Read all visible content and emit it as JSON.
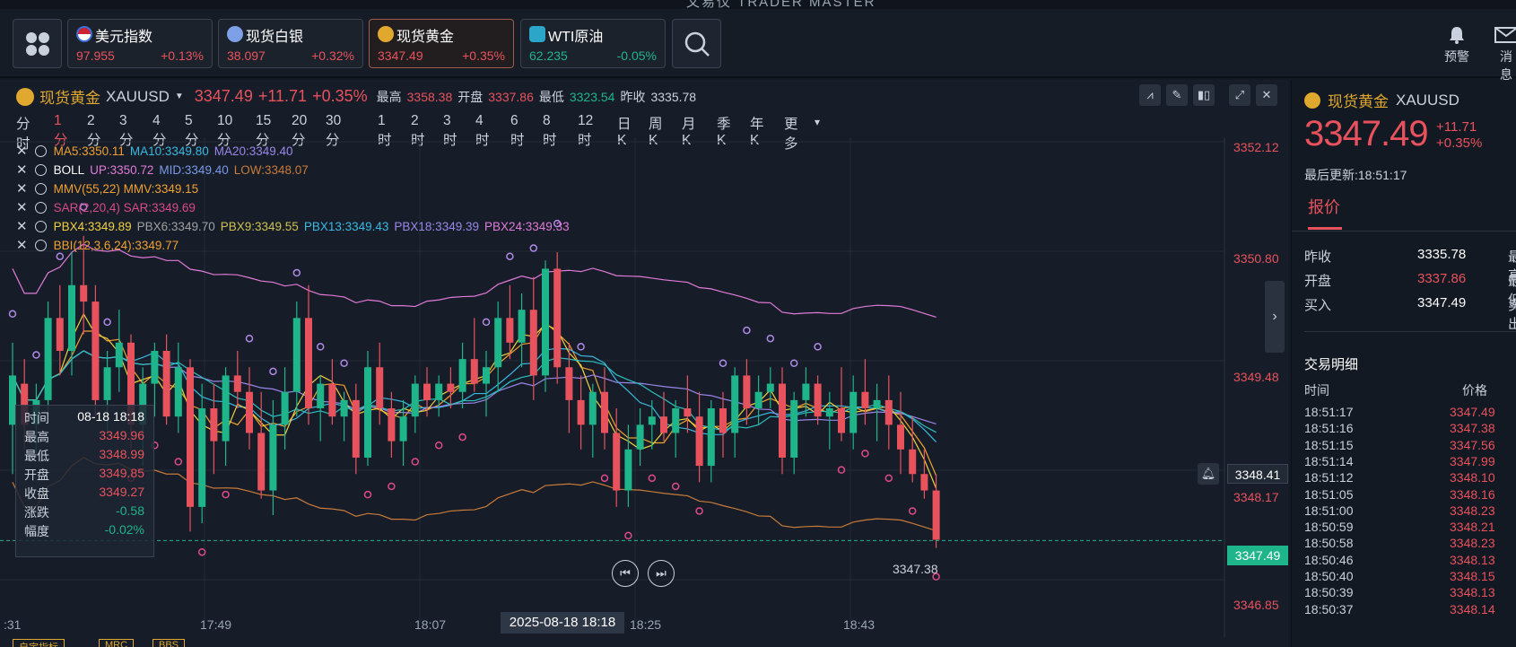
{
  "window": {
    "title": "文易仪 TRADER MASTER"
  },
  "header": {
    "tickers": [
      {
        "name": "美元指数",
        "price": "97.955",
        "change": "+0.13%",
        "icon": "us-flag-icon",
        "color": "#3a6fd8"
      },
      {
        "name": "现货白银",
        "price": "38.097",
        "change": "+0.32%",
        "icon": "silver-icon",
        "color": "#7da0e8"
      },
      {
        "name": "现货黄金",
        "price": "3347.49",
        "change": "+0.35%",
        "icon": "gold-icon",
        "color": "#e0a82e"
      },
      {
        "name": "WTI原油",
        "price": "62.235",
        "change": "-0.05%",
        "icon": "oil-icon",
        "color": "#2ba6c8"
      }
    ],
    "alerts_label": "预警",
    "messages_label": "消息"
  },
  "chart_header": {
    "symbol_name": "现货黄金",
    "symbol_code": "XAUUSD",
    "price": "3347.49",
    "change": "+11.71",
    "change_pct": "+0.35%",
    "high_label": "最高",
    "high": "3358.38",
    "open_label": "开盘",
    "open": "3337.86",
    "low_label": "最低",
    "low": "3323.54",
    "prev_label": "昨收",
    "prev": "3335.78"
  },
  "intervals": [
    "分时",
    "1分",
    "2分",
    "3分",
    "4分",
    "5分",
    "10分",
    "15分",
    "20分",
    "30分",
    "1时",
    "2时",
    "3时",
    "4时",
    "6时",
    "8时",
    "12时",
    "日K",
    "周K",
    "月K",
    "季K",
    "年K",
    "更多"
  ],
  "indicators": [
    {
      "parts": [
        {
          "t": "MA5:3350.11",
          "c": "#f0a030"
        },
        {
          "t": "MA10:3349.80",
          "c": "#3ab8e0"
        },
        {
          "t": "MA20:3349.40",
          "c": "#9a86e8"
        }
      ]
    },
    {
      "parts": [
        {
          "t": "BOLL",
          "c": "#ffffff"
        },
        {
          "t": "UP:3350.72",
          "c": "#e07ad8"
        },
        {
          "t": "MID:3349.40",
          "c": "#7a9ae8"
        },
        {
          "t": "LOW:3348.07",
          "c": "#c87a3a"
        }
      ]
    },
    {
      "parts": [
        {
          "t": "MMV(55,22) MMV:3349.15",
          "c": "#f0a030"
        }
      ]
    },
    {
      "parts": [
        {
          "t": "SAR(2,20,4) SAR:3349.69",
          "c": "#d84a8a"
        }
      ]
    },
    {
      "parts": [
        {
          "t": "PBX4:3349.89",
          "c": "#f0d040"
        },
        {
          "t": "PBX6:3349.70",
          "c": "#a0a0a0"
        },
        {
          "t": "PBX9:3349.55",
          "c": "#d0c050"
        },
        {
          "t": "PBX13:3349.43",
          "c": "#3ab8e0"
        },
        {
          "t": "PBX18:3349.39",
          "c": "#9a86e8"
        },
        {
          "t": "PBX24:3349.33",
          "c": "#e07ad8"
        }
      ]
    },
    {
      "parts": [
        {
          "t": "BBI(12,3,6,24):3349.77",
          "c": "#f0a030"
        }
      ]
    }
  ],
  "tooltip": [
    {
      "k": "时间",
      "v": "08-18 18:18",
      "c": "#ffffff"
    },
    {
      "k": "最高",
      "v": "3349.96",
      "c": "#e8525d"
    },
    {
      "k": "最低",
      "v": "3348.99",
      "c": "#e8525d"
    },
    {
      "k": "开盘",
      "v": "3349.85",
      "c": "#e8525d"
    },
    {
      "k": "收盘",
      "v": "3349.27",
      "c": "#e8525d"
    },
    {
      "k": "涨跌",
      "v": "-0.58",
      "c": "#1fb58a"
    },
    {
      "k": "幅度",
      "v": "-0.02%",
      "c": "#1fb58a"
    }
  ],
  "y_axis": {
    "ticks": [
      "3352.12",
      "3350.80",
      "3349.48",
      "3348.17",
      "3346.85"
    ],
    "crosshair_value": "3348.41",
    "last_price": "3347.49",
    "last_candle_low": "3347.38"
  },
  "x_axis": {
    "ticks": [
      ":31",
      "17:49",
      "18:07",
      "18:25",
      "18:43"
    ],
    "crosshair_time": "2025-08-18 18:18"
  },
  "chart_data": {
    "type": "candlestick",
    "ylim": [
      3346.5,
      3352.4
    ],
    "candles": [
      [
        3348.9,
        3349.9,
        3348.3,
        3349.5
      ],
      [
        3349.4,
        3349.7,
        3348.6,
        3348.9
      ],
      [
        3348.9,
        3349.4,
        3348.5,
        3349.2
      ],
      [
        3349.2,
        3350.4,
        3349.0,
        3350.2
      ],
      [
        3350.2,
        3350.6,
        3349.5,
        3349.8
      ],
      [
        3349.8,
        3351.0,
        3349.5,
        3350.6
      ],
      [
        3350.6,
        3351.2,
        3350.0,
        3350.4
      ],
      [
        3350.4,
        3350.6,
        3349.0,
        3349.2
      ],
      [
        3349.2,
        3349.8,
        3348.8,
        3349.6
      ],
      [
        3349.6,
        3350.3,
        3349.3,
        3349.9
      ],
      [
        3349.9,
        3350.0,
        3348.6,
        3348.9
      ],
      [
        3348.9,
        3349.6,
        3348.4,
        3349.4
      ],
      [
        3349.4,
        3349.9,
        3349.0,
        3349.8
      ],
      [
        3349.8,
        3350.0,
        3348.9,
        3349.0
      ],
      [
        3349.0,
        3349.9,
        3348.8,
        3349.6
      ],
      [
        3349.6,
        3349.7,
        3347.6,
        3347.9
      ],
      [
        3347.9,
        3349.4,
        3347.7,
        3349.1
      ],
      [
        3349.1,
        3349.4,
        3348.3,
        3348.7
      ],
      [
        3348.7,
        3349.6,
        3348.4,
        3349.5
      ],
      [
        3349.5,
        3349.8,
        3349.1,
        3349.3
      ],
      [
        3349.3,
        3349.6,
        3348.6,
        3348.8
      ],
      [
        3348.8,
        3349.3,
        3348.0,
        3348.1
      ],
      [
        3348.1,
        3349.2,
        3347.8,
        3348.9
      ],
      [
        3348.9,
        3349.6,
        3348.6,
        3349.3
      ],
      [
        3349.3,
        3350.4,
        3349.0,
        3350.2
      ],
      [
        3350.2,
        3350.6,
        3348.9,
        3349.1
      ],
      [
        3349.1,
        3349.5,
        3348.7,
        3349.4
      ],
      [
        3349.4,
        3349.7,
        3348.9,
        3349.0
      ],
      [
        3349.0,
        3349.3,
        3348.7,
        3349.2
      ],
      [
        3349.2,
        3349.4,
        3348.3,
        3348.5
      ],
      [
        3348.5,
        3349.8,
        3348.4,
        3349.6
      ],
      [
        3349.6,
        3349.9,
        3348.9,
        3349.1
      ],
      [
        3349.1,
        3349.3,
        3348.5,
        3348.7
      ],
      [
        3348.7,
        3349.2,
        3348.4,
        3349.0
      ],
      [
        3349.0,
        3349.5,
        3348.8,
        3349.4
      ],
      [
        3349.4,
        3349.6,
        3349.0,
        3349.2
      ],
      [
        3349.2,
        3349.5,
        3349.0,
        3349.4
      ],
      [
        3349.4,
        3349.6,
        3349.1,
        3349.3
      ],
      [
        3349.3,
        3349.9,
        3349.1,
        3349.7
      ],
      [
        3349.7,
        3350.2,
        3349.3,
        3349.4
      ],
      [
        3349.4,
        3349.8,
        3349.0,
        3349.6
      ],
      [
        3349.6,
        3350.4,
        3349.3,
        3350.2
      ],
      [
        3350.2,
        3350.6,
        3349.7,
        3349.9
      ],
      [
        3349.9,
        3350.5,
        3349.6,
        3350.3
      ],
      [
        3350.3,
        3350.7,
        3349.2,
        3349.5
      ],
      [
        3349.5,
        3350.9,
        3349.3,
        3350.8
      ],
      [
        3350.8,
        3351.0,
        3349.4,
        3349.6
      ],
      [
        3349.6,
        3349.9,
        3348.8,
        3349.2
      ],
      [
        3349.2,
        3349.5,
        3348.6,
        3348.9
      ],
      [
        3348.9,
        3349.4,
        3348.5,
        3349.3
      ],
      [
        3349.3,
        3349.6,
        3348.6,
        3348.8
      ],
      [
        3348.8,
        3349.1,
        3347.9,
        3348.1
      ],
      [
        3348.1,
        3348.9,
        3347.9,
        3348.6
      ],
      [
        3348.6,
        3349.1,
        3348.4,
        3348.9
      ],
      [
        3348.9,
        3349.2,
        3348.6,
        3349.0
      ],
      [
        3349.0,
        3349.3,
        3348.7,
        3348.8
      ],
      [
        3348.8,
        3349.2,
        3348.5,
        3349.1
      ],
      [
        3349.1,
        3349.5,
        3348.8,
        3349.0
      ],
      [
        3349.0,
        3349.3,
        3348.2,
        3348.4
      ],
      [
        3348.4,
        3349.2,
        3348.2,
        3349.1
      ],
      [
        3349.1,
        3349.3,
        3348.5,
        3348.8
      ],
      [
        3348.8,
        3349.6,
        3348.5,
        3349.5
      ],
      [
        3349.5,
        3349.7,
        3348.9,
        3349.1
      ],
      [
        3349.1,
        3349.5,
        3348.9,
        3349.3
      ],
      [
        3349.3,
        3349.6,
        3349.1,
        3349.4
      ],
      [
        3349.4,
        3349.6,
        3348.3,
        3348.5
      ],
      [
        3348.5,
        3349.3,
        3348.3,
        3349.2
      ],
      [
        3349.2,
        3349.6,
        3349.0,
        3349.4
      ],
      [
        3349.4,
        3349.5,
        3348.9,
        3349.0
      ],
      [
        3349.0,
        3349.3,
        3348.6,
        3349.1
      ],
      [
        3349.1,
        3349.6,
        3348.7,
        3348.8
      ],
      [
        3348.8,
        3349.5,
        3348.6,
        3349.3
      ],
      [
        3349.3,
        3349.7,
        3348.9,
        3349.1
      ],
      [
        3349.1,
        3349.4,
        3348.7,
        3349.2
      ],
      [
        3349.2,
        3349.5,
        3348.6,
        3348.9
      ],
      [
        3348.9,
        3349.3,
        3348.3,
        3348.6
      ],
      [
        3348.6,
        3349.0,
        3348.2,
        3348.3
      ],
      [
        3348.3,
        3348.6,
        3348.0,
        3348.1
      ],
      [
        3348.1,
        3348.3,
        3347.4,
        3347.5
      ]
    ]
  },
  "right_panel": {
    "symbol_name": "现货黄金",
    "symbol_code": "XAUUSD",
    "price": "3347.49",
    "change": "+11.71",
    "change_pct": "+0.35%",
    "updated": "最后更新:18:51:17",
    "tab": "报价",
    "quote": [
      {
        "k": "昨收",
        "v": "3335.78",
        "c": "#ffffff",
        "k2": "最高"
      },
      {
        "k": "开盘",
        "v": "3337.86",
        "c": "#e8525d",
        "k2": "最低"
      },
      {
        "k": "买入",
        "v": "3347.49",
        "c": "#ffffff",
        "k2": "卖出"
      }
    ],
    "trades_title": "交易明细",
    "col_time": "时间",
    "col_price": "价格",
    "trades": [
      {
        "t": "18:51:17",
        "p": "3347.49"
      },
      {
        "t": "18:51:16",
        "p": "3347.38"
      },
      {
        "t": "18:51:15",
        "p": "3347.56"
      },
      {
        "t": "18:51:14",
        "p": "3347.99"
      },
      {
        "t": "18:51:12",
        "p": "3348.10"
      },
      {
        "t": "18:51:05",
        "p": "3348.16"
      },
      {
        "t": "18:51:00",
        "p": "3348.23"
      },
      {
        "t": "18:50:59",
        "p": "3348.21"
      },
      {
        "t": "18:50:58",
        "p": "3348.23"
      },
      {
        "t": "18:50:46",
        "p": "3348.13"
      },
      {
        "t": "18:50:40",
        "p": "3348.15"
      },
      {
        "t": "18:50:39",
        "p": "3348.13"
      },
      {
        "t": "18:50:37",
        "p": "3348.14"
      }
    ]
  },
  "bottom_tabs": [
    "自定指标",
    "MRC",
    "BBS"
  ]
}
